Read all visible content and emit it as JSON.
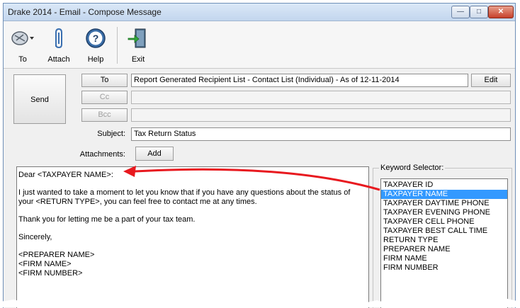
{
  "window": {
    "title": "Drake 2014 - Email - Compose Message"
  },
  "toolbar": {
    "to_label": "To",
    "attach_label": "Attach",
    "help_label": "Help",
    "exit_label": "Exit"
  },
  "header": {
    "send_label": "Send",
    "to_button": "To",
    "cc_button": "Cc",
    "bcc_button": "Bcc",
    "to_value": "Report Generated Recipient List - Contact List (Individual) - As of 12-11-2014",
    "cc_value": "",
    "bcc_value": "",
    "edit_label": "Edit",
    "subject_label": "Subject:",
    "subject_value": "Tax Return Status",
    "attachments_label": "Attachments:",
    "add_label": "Add"
  },
  "message": {
    "line1": "Dear <TAXPAYER NAME>:",
    "line2a": "I just wanted to take a moment to let you know that if you have any questions about the status of",
    "line2b": "your <RETURN TYPE>, you can feel free to contact me at any times.",
    "line3": "Thank you for letting me be a part of your tax team.",
    "line4": "Sincerely,",
    "line5": "<PREPARER NAME>",
    "line6": "<FIRM NAME>",
    "line7": "<FIRM NUMBER>"
  },
  "keywords": {
    "title": "Keyword Selector:",
    "items": [
      "TAXPAYER ID",
      "TAXPAYER NAME",
      "TAXPAYER DAYTIME PHONE",
      "TAXPAYER EVENING PHONE",
      "TAXPAYER CELL PHONE",
      "TAXPAYER BEST CALL TIME",
      "RETURN TYPE",
      "PREPARER NAME",
      "FIRM NAME",
      "FIRM NUMBER"
    ],
    "selected": "TAXPAYER NAME"
  },
  "colors": {
    "selection": "#3399ff",
    "annotation_arrow": "#e8191f"
  }
}
